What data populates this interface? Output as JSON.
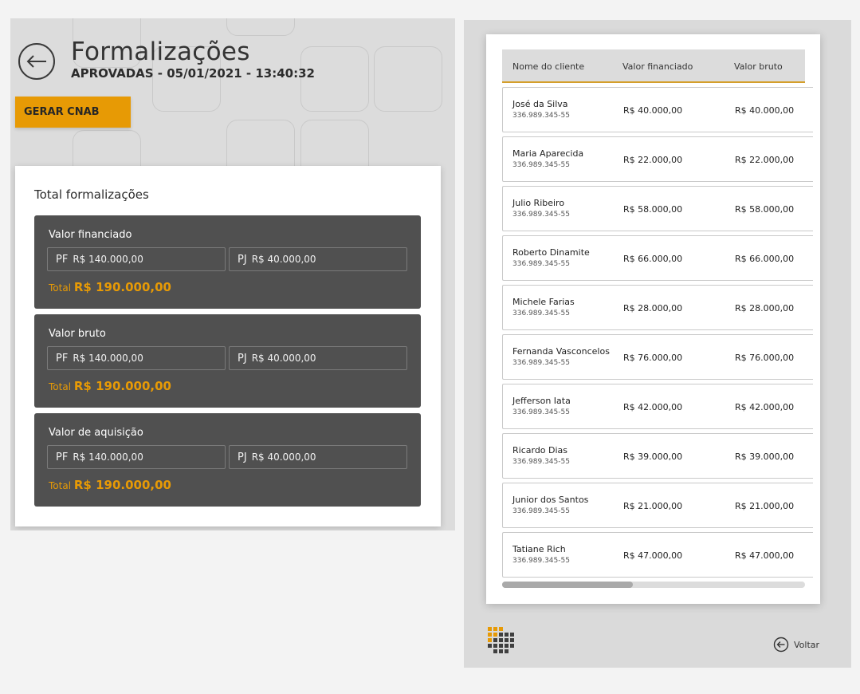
{
  "header": {
    "title": "Formalizações",
    "subtitle": "APROVADAS - 05/01/2021 - 13:40:32",
    "action_button": "GERAR CNAB"
  },
  "summary": {
    "title": "Total formalizações",
    "blocks": [
      {
        "label": "Valor financiado",
        "pf_prefix": "PF",
        "pf_value": "R$ 140.000,00",
        "pj_prefix": "PJ",
        "pj_value": "R$ 40.000,00",
        "total_prefix": "Total",
        "total_value": "R$ 190.000,00"
      },
      {
        "label": "Valor bruto",
        "pf_prefix": "PF",
        "pf_value": "R$ 140.000,00",
        "pj_prefix": "PJ",
        "pj_value": "R$ 40.000,00",
        "total_prefix": "Total",
        "total_value": "R$ 190.000,00"
      },
      {
        "label": "Valor de aquisição",
        "pf_prefix": "PF",
        "pf_value": "R$ 140.000,00",
        "pj_prefix": "PJ",
        "pj_value": "R$ 40.000,00",
        "total_prefix": "Total",
        "total_value": "R$ 190.000,00"
      }
    ]
  },
  "table": {
    "columns": [
      "Nome do cliente",
      "Valor financiado",
      "Valor bruto"
    ],
    "rows": [
      {
        "name": "José da Silva",
        "doc": "336.989.345-55",
        "financiado": "R$ 40.000,00",
        "bruto": "R$ 40.000,00"
      },
      {
        "name": "Maria Aparecida",
        "doc": "336.989.345-55",
        "financiado": "R$ 22.000,00",
        "bruto": "R$ 22.000,00"
      },
      {
        "name": "Julio Ribeiro",
        "doc": "336.989.345-55",
        "financiado": "R$ 58.000,00",
        "bruto": "R$ 58.000,00"
      },
      {
        "name": "Roberto Dinamite",
        "doc": "336.989.345-55",
        "financiado": "R$ 66.000,00",
        "bruto": "R$ 66.000,00"
      },
      {
        "name": "Michele Farias",
        "doc": "336.989.345-55",
        "financiado": "R$ 28.000,00",
        "bruto": "R$ 28.000,00"
      },
      {
        "name": "Fernanda Vasconcelos",
        "doc": "336.989.345-55",
        "financiado": "R$ 76.000,00",
        "bruto": "R$ 76.000,00"
      },
      {
        "name": "Jefferson Iata",
        "doc": "336.989.345-55",
        "financiado": "R$ 42.000,00",
        "bruto": "R$ 42.000,00"
      },
      {
        "name": "Ricardo Dias",
        "doc": "336.989.345-55",
        "financiado": "R$ 39.000,00",
        "bruto": "R$ 39.000,00"
      },
      {
        "name": "Junior dos Santos",
        "doc": "336.989.345-55",
        "financiado": "R$ 21.000,00",
        "bruto": "R$ 21.000,00"
      },
      {
        "name": "Tatiane Rich",
        "doc": "336.989.345-55",
        "financiado": "R$ 47.000,00",
        "bruto": "R$ 47.000,00"
      }
    ]
  },
  "footer": {
    "back_label": "Voltar"
  },
  "icons": {
    "back": "arrow-left-circle-icon",
    "logo": "grid-logo-icon"
  },
  "colors": {
    "accent": "#e79a05",
    "block_bg": "#505050",
    "panel_bg": "#dcdcdc"
  }
}
